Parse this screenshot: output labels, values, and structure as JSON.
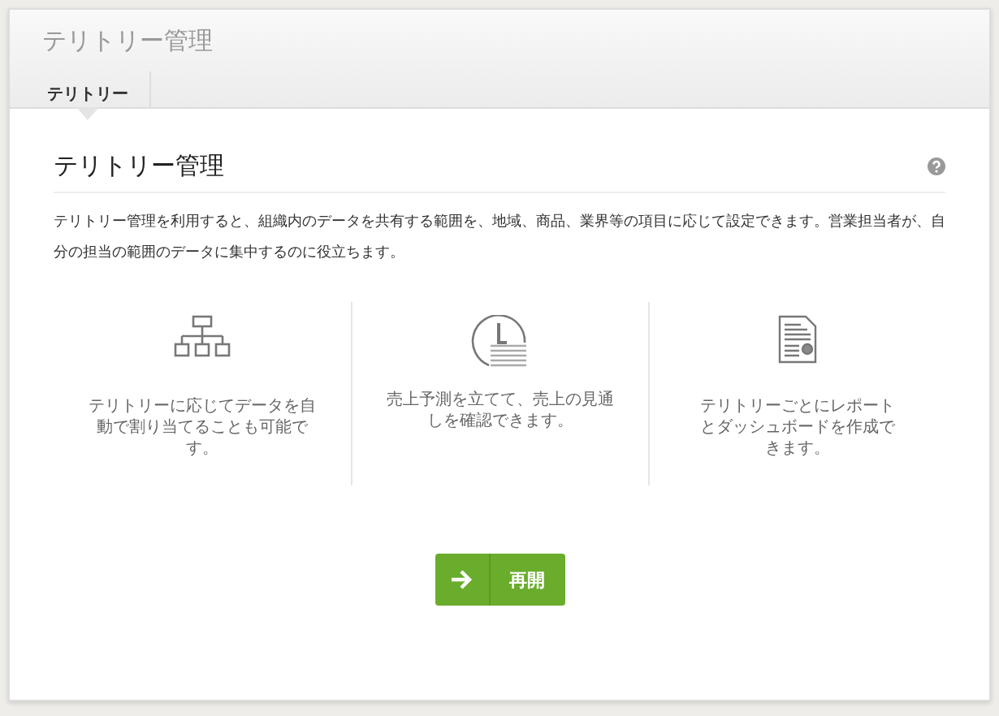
{
  "page_title": "テリトリー管理",
  "tabs": [
    {
      "label": "テリトリー",
      "selected": true
    }
  ],
  "section": {
    "title": "テリトリー管理",
    "description": "テリトリー管理を利用すると、組織内のデータを共有する範囲を、地域、商品、業界等の項目に応じて設定できます。営業担当者が、自分の担当の範囲のデータに集中するのに役立ちます。"
  },
  "features": [
    {
      "kind": "hierarchy",
      "text": "テリトリーに応じてデータを自動で割り当てることも可能です。"
    },
    {
      "kind": "forecast",
      "text": "売上予測を立てて、売上の見通しを確認できます。"
    },
    {
      "kind": "report",
      "text": "テリトリーごとにレポートとダッシュボードを作成できます。"
    }
  ],
  "button": {
    "label": "再開"
  }
}
